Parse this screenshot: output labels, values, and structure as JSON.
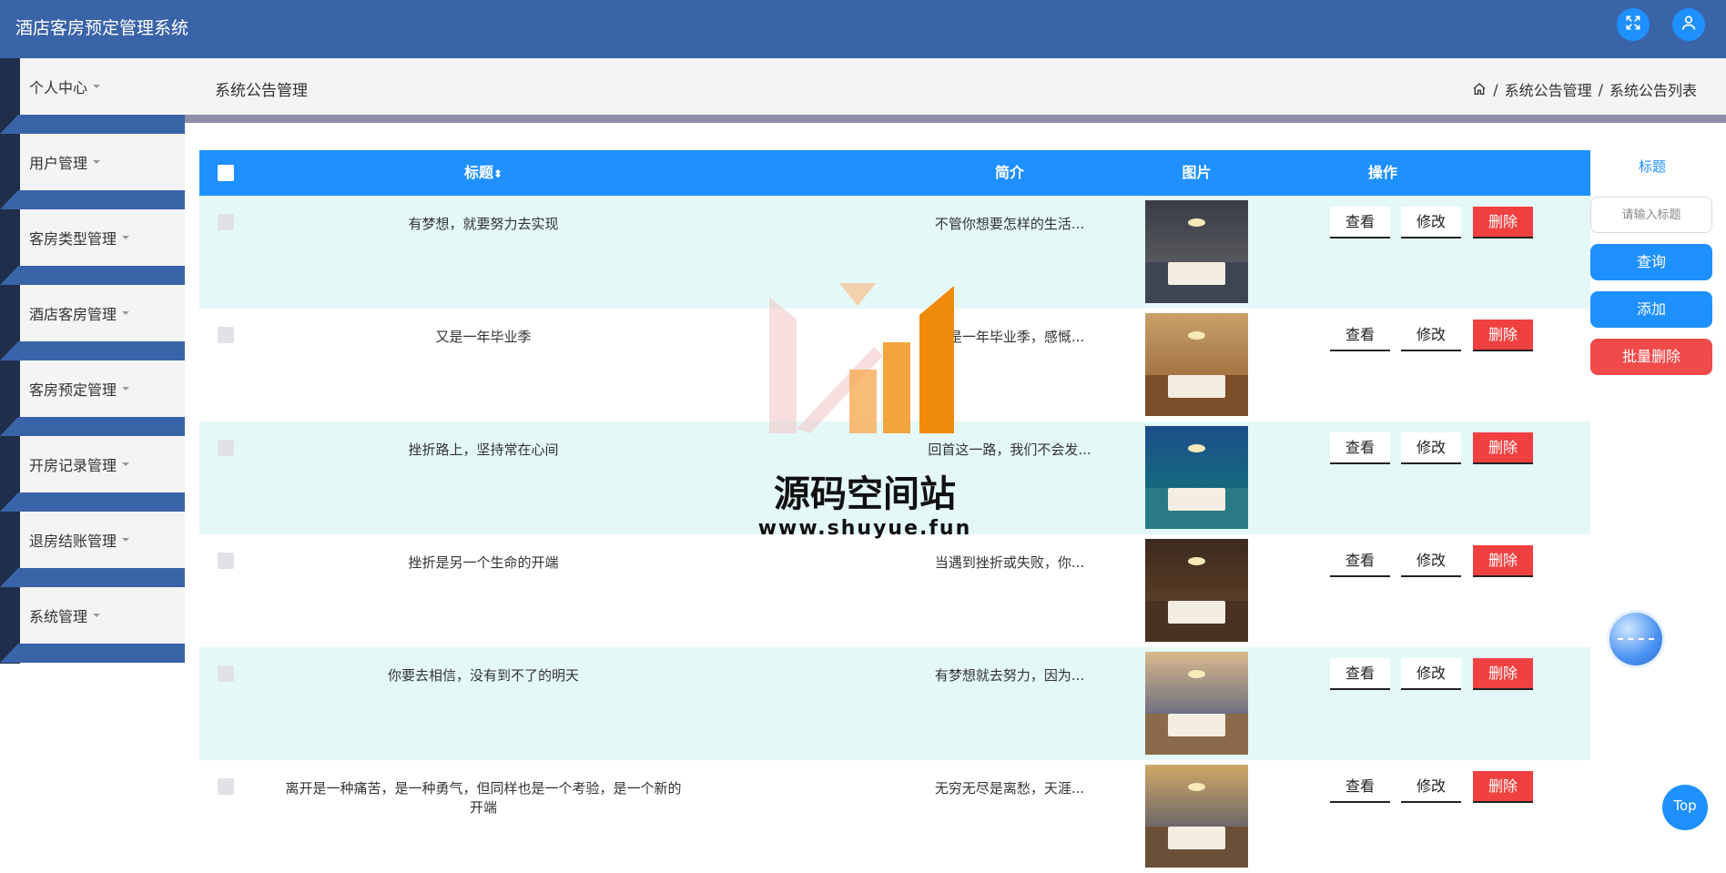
{
  "app": {
    "title": "酒店客房预定管理系统"
  },
  "topbar": {
    "fullscreen_icon": "expand-arrows-icon",
    "user_icon": "user-icon"
  },
  "sidebar": {
    "items": [
      {
        "label": "个人中心"
      },
      {
        "label": "用户管理"
      },
      {
        "label": "客房类型管理"
      },
      {
        "label": "酒店客房管理"
      },
      {
        "label": "客房预定管理"
      },
      {
        "label": "开房记录管理"
      },
      {
        "label": "退房结账管理"
      },
      {
        "label": "系统管理"
      }
    ]
  },
  "header": {
    "title": "系统公告管理",
    "breadcrumb": {
      "sep1": "/",
      "level1": "系统公告管理",
      "sep2": "/",
      "level2": "系统公告列表"
    }
  },
  "table": {
    "columns": {
      "title": "标题",
      "sort_icon": "⬍",
      "intro": "简介",
      "image": "图片",
      "actions": "操作"
    },
    "action_labels": {
      "view": "查看",
      "edit": "修改",
      "delete": "删除"
    },
    "rows": [
      {
        "title": "有梦想，就要努力去实现",
        "intro": "不管你想要怎样的生活..."
      },
      {
        "title": "又是一年毕业季",
        "intro": "又是一年毕业季，感慨..."
      },
      {
        "title": "挫折路上，坚持常在心间",
        "intro": "回首这一路，我们不会发..."
      },
      {
        "title": "挫折是另一个生命的开端",
        "intro": "当遇到挫折或失败，你..."
      },
      {
        "title": "你要去相信，没有到不了的明天",
        "intro": "有梦想就去努力，因为..."
      },
      {
        "title": "离开是一种痛苦，是一种勇气，但同样也是一个考验，是一个新的开端",
        "intro": "无穷无尽是离愁，天涯..."
      }
    ]
  },
  "search": {
    "label": "标题",
    "placeholder": "请输入标题",
    "query_label": "查询",
    "add_label": "添加",
    "batch_delete_label": "批量删除"
  },
  "floating": {
    "top_label": "Top"
  },
  "watermark": {
    "name": "源码空间站",
    "url": "www.shuyue.fun"
  },
  "colors": {
    "topbar": "#3a64a8",
    "accent": "#1e90ff",
    "danger": "#f04040",
    "row_alt": "#e4f8f8"
  }
}
